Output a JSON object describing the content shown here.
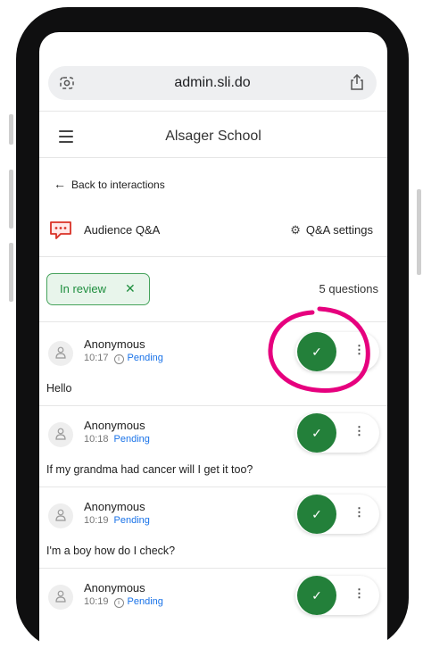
{
  "browser": {
    "url": "admin.sli.do"
  },
  "header": {
    "title": "Alsager School"
  },
  "nav": {
    "back": "Back to interactions"
  },
  "qa": {
    "title": "Audience Q&A",
    "settings": "Q&A settings"
  },
  "filter": {
    "chip": "In review",
    "count": "5 questions"
  },
  "questions": [
    {
      "author": "Anonymous",
      "time": "10:17",
      "status": "Pending",
      "text": "Hello"
    },
    {
      "author": "Anonymous",
      "time": "10:18",
      "status": "Pending",
      "text": "If my grandma had cancer will I get it too?"
    },
    {
      "author": "Anonymous",
      "time": "10:19",
      "status": "Pending",
      "text": "I'm a boy how do I check?"
    },
    {
      "author": "Anonymous",
      "time": "10:19",
      "status": "Pending",
      "text": ""
    }
  ],
  "colors": {
    "accent": "#23803a",
    "chip_bg": "#e8f5eb",
    "status": "#1a73e8",
    "annotation": "#e6007e"
  },
  "icons": {
    "approve": "check-icon",
    "more": "more-vert-icon",
    "menu": "hamburger-icon",
    "share": "share-icon",
    "settings": "gear-icon"
  }
}
